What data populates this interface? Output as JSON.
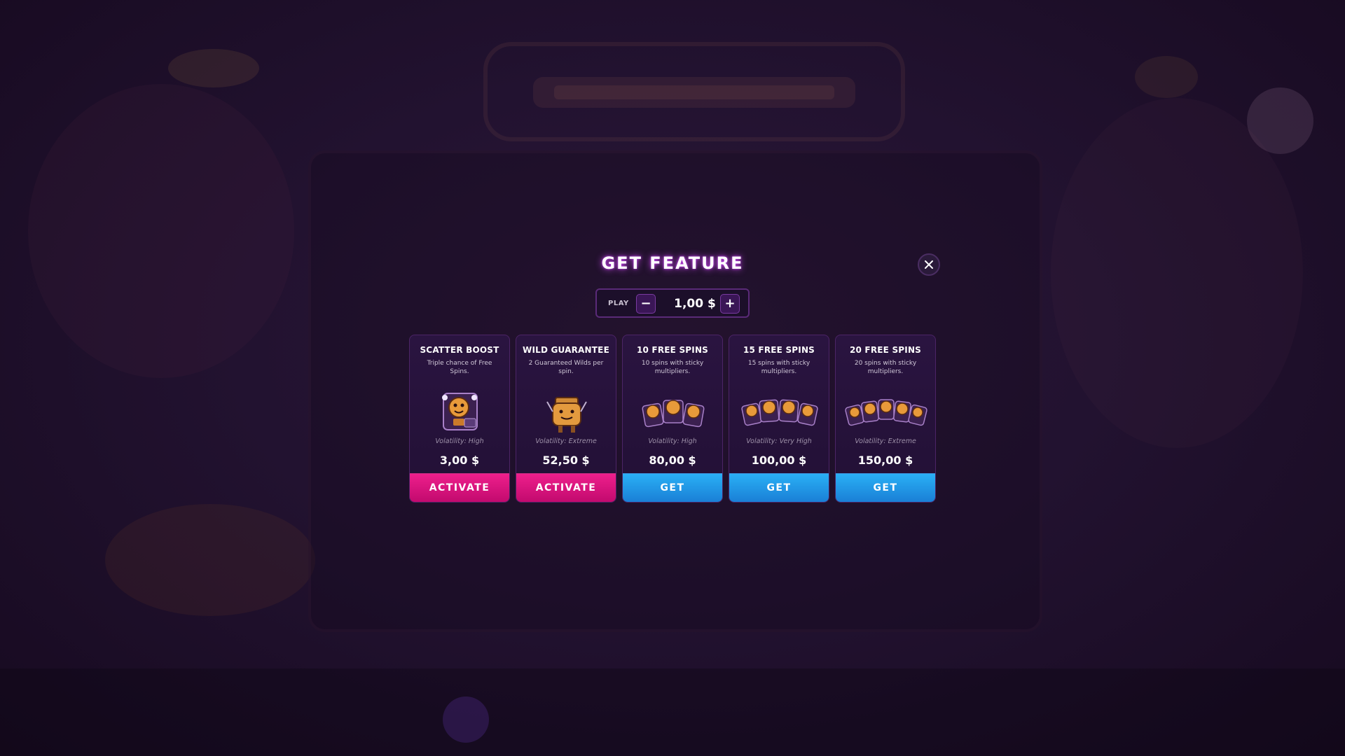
{
  "modal": {
    "title": "GET FEATURE",
    "bet": {
      "label": "PLAY",
      "value": "1,00 $",
      "minus": "−",
      "plus": "+"
    }
  },
  "cards": [
    {
      "title": "SCATTER BOOST",
      "desc": "Triple chance of Free Spins.",
      "volatility": "Volatility: High",
      "price": "3,00 $",
      "button": "ACTIVATE",
      "button_color": "#e0157d",
      "art": "scatter-character-icon"
    },
    {
      "title": "WILD GUARANTEE",
      "desc": "2 Guaranteed Wilds per spin.",
      "volatility": "Volatility: Extreme",
      "price": "52,50 $",
      "button": "ACTIVATE",
      "button_color": "#e0157d",
      "art": "cooking-pot-character-icon"
    },
    {
      "title": "10 FREE SPINS",
      "desc": "10 spins with sticky multipliers.",
      "volatility": "Volatility: High",
      "price": "80,00 $",
      "button": "GET",
      "button_color": "#1f95e6",
      "art": "free-spins-cards-icon"
    },
    {
      "title": "15 FREE SPINS",
      "desc": "15 spins with sticky multipliers.",
      "volatility": "Volatility: Very High",
      "price": "100,00 $",
      "button": "GET",
      "button_color": "#1f95e6",
      "art": "free-spins-cards-icon"
    },
    {
      "title": "20 FREE SPINS",
      "desc": "20 spins with sticky multipliers.",
      "volatility": "Volatility: Extreme",
      "price": "150,00 $",
      "button": "GET",
      "button_color": "#1f95e6",
      "art": "free-spins-cards-icon"
    }
  ],
  "colors": {
    "title_glow": "#dc50ff",
    "activate": "#e0157d",
    "get": "#1f95e6",
    "card_bg": "#251238"
  }
}
